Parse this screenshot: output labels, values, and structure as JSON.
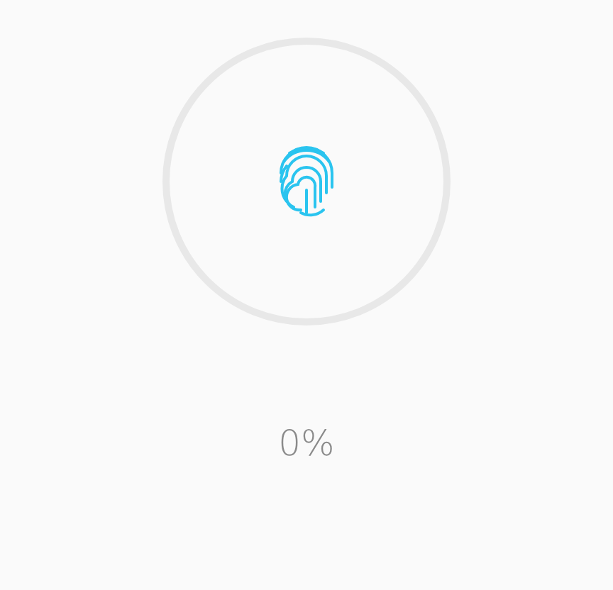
{
  "progress": {
    "reading": "0%"
  }
}
